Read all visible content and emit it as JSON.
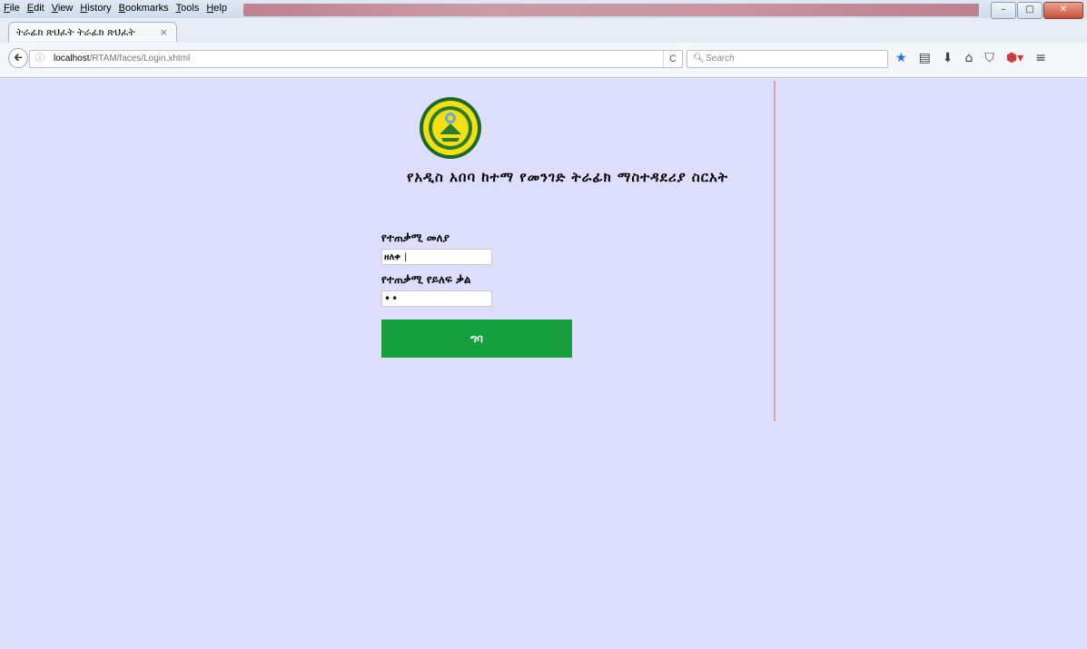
{
  "menu": [
    "File",
    "Edit",
    "View",
    "History",
    "Bookmarks",
    "Tools",
    "Help"
  ],
  "tab": {
    "title": "ትራፊክ ጽህፈት ትራፊክ ጽህፈት",
    "close": "×"
  },
  "toolbar": {
    "info_icon": "info-icon",
    "url_host": "localhost",
    "url_path": "/RTAM/faces/Login.xhtml",
    "reload": "C",
    "search_placeholder": "Search",
    "window_buttons": [
      "minimize",
      "maximize",
      "close"
    ]
  },
  "page": {
    "heading": "የአዲስ አበባ ከተማ የመንገድ ትራፊክ ማስተዳደሪያ ስርአት",
    "username_label": "የተጠቃሚ መለያ",
    "username_value": "ዘለቀ",
    "password_label": "የተጠቃሚ የይለፍ ቃል",
    "password_value": "••",
    "submit_label": "ግባ",
    "logo": "seal"
  },
  "colors": {
    "accent": "#16a03d",
    "background": "#dcdefc",
    "divider": "#d8a79a"
  }
}
